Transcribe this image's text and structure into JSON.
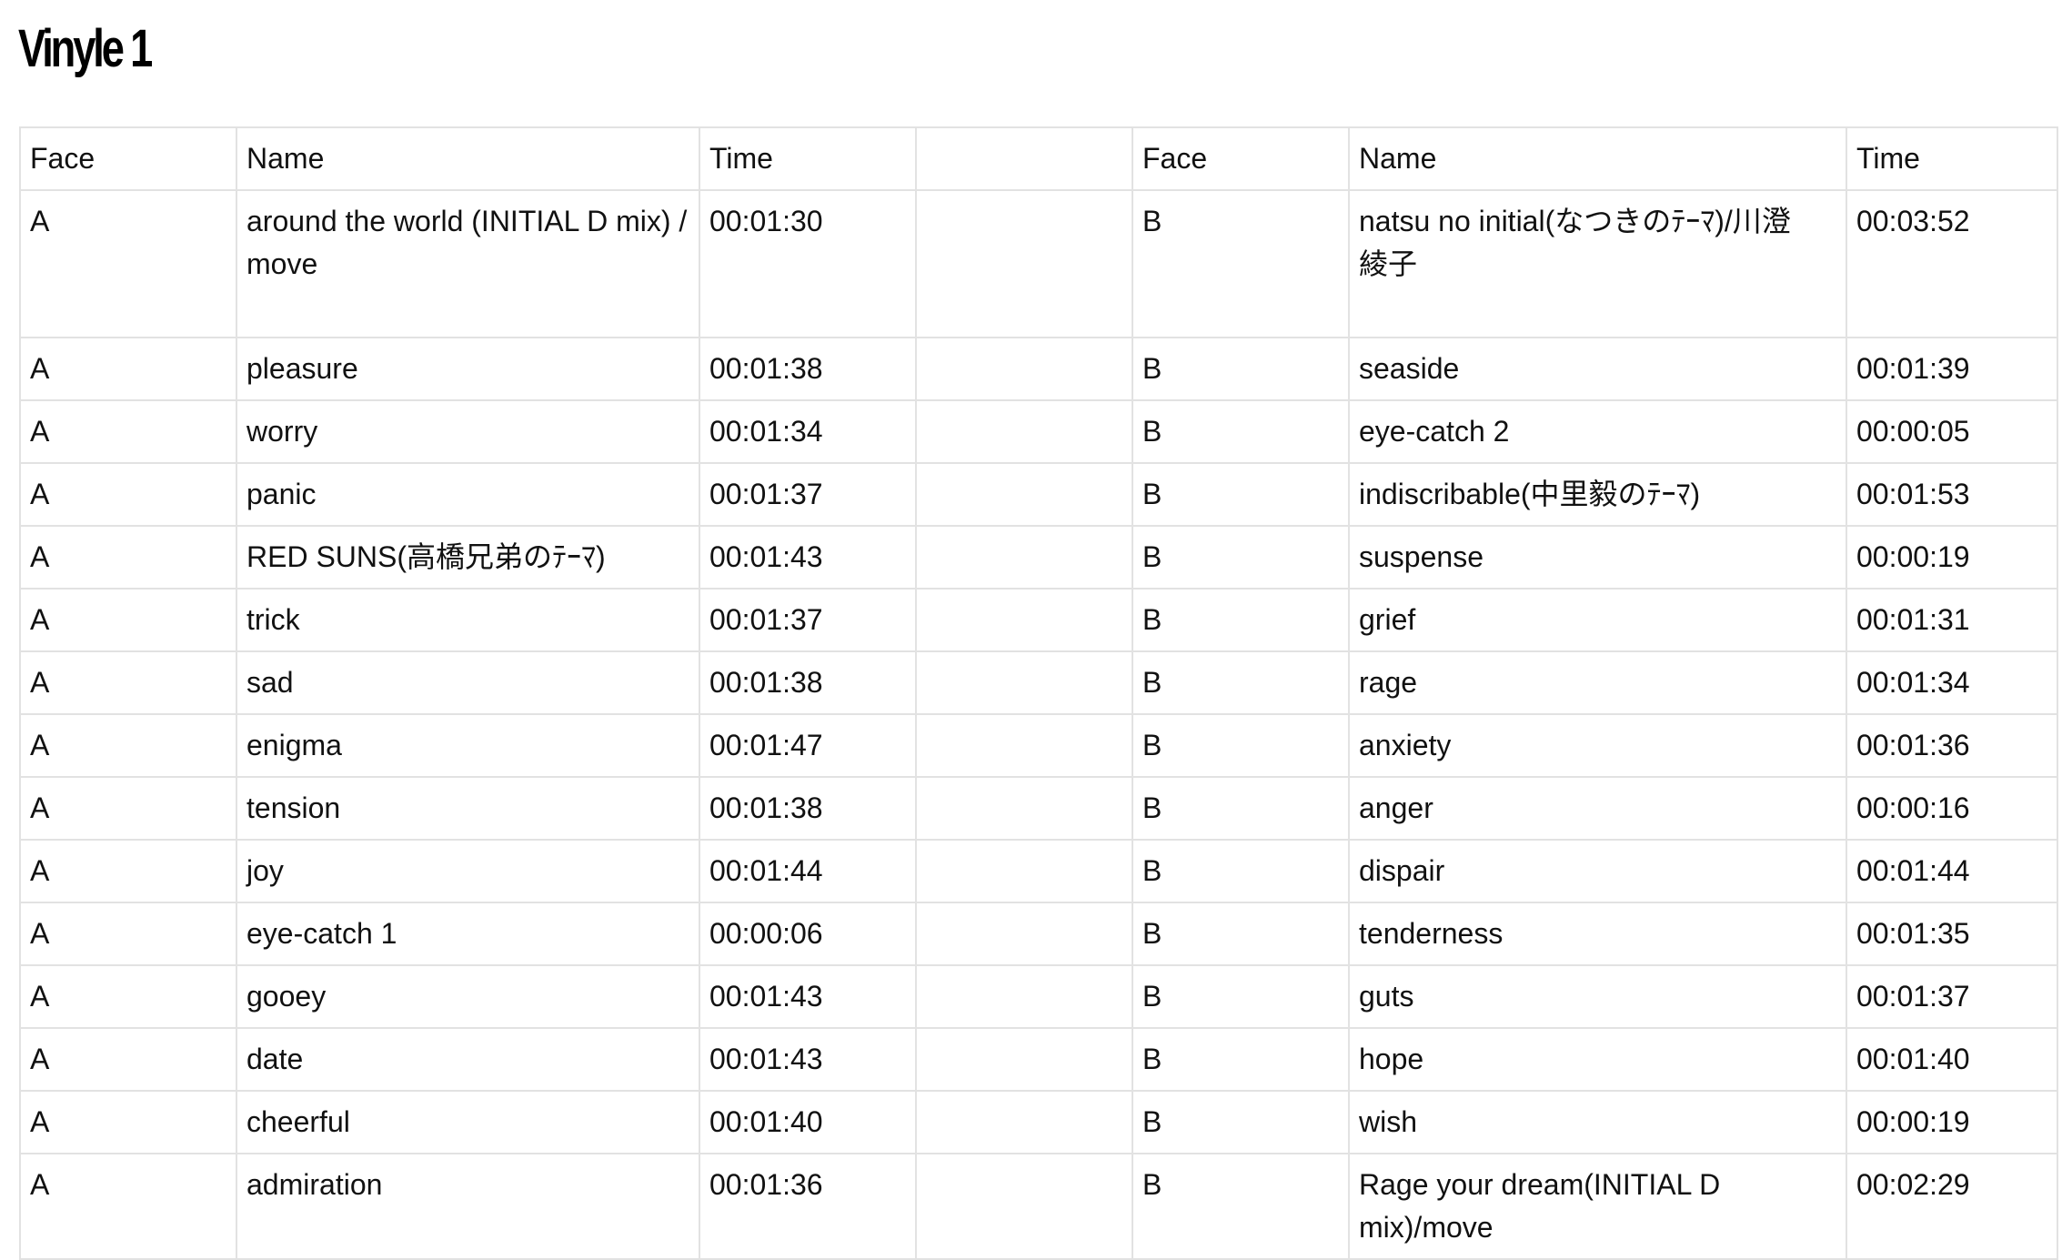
{
  "title": "Vinyle 1",
  "table": {
    "headers": [
      "Face",
      "Name",
      "Time",
      "",
      "Face",
      "Name",
      "Time"
    ],
    "rows": [
      {
        "face_a": "A",
        "name_a": "around the world (INITIAL D mix) / move",
        "time_a": "00:01:30",
        "face_b": "B",
        "name_b": "natsu no initial(なつきのﾃｰﾏ)/川澄\n綾子",
        "time_b": "00:03:52"
      },
      {
        "face_a": "A",
        "name_a": "pleasure",
        "time_a": "00:01:38",
        "face_b": "B",
        "name_b": "seaside",
        "time_b": "00:01:39"
      },
      {
        "face_a": "A",
        "name_a": "worry",
        "time_a": "00:01:34",
        "face_b": "B",
        "name_b": "eye-catch 2",
        "time_b": "00:00:05"
      },
      {
        "face_a": "A",
        "name_a": "panic",
        "time_a": "00:01:37",
        "face_b": "B",
        "name_b": "indiscribable(中里毅のﾃｰﾏ)",
        "time_b": "00:01:53"
      },
      {
        "face_a": "A",
        "name_a": "RED SUNS(高橋兄弟のﾃｰﾏ)",
        "time_a": "00:01:43",
        "face_b": "B",
        "name_b": "suspense",
        "time_b": "00:00:19"
      },
      {
        "face_a": "A",
        "name_a": "trick",
        "time_a": "00:01:37",
        "face_b": "B",
        "name_b": "grief",
        "time_b": "00:01:31"
      },
      {
        "face_a": "A",
        "name_a": "sad",
        "time_a": "00:01:38",
        "face_b": "B",
        "name_b": "rage",
        "time_b": "00:01:34"
      },
      {
        "face_a": "A",
        "name_a": "enigma",
        "time_a": "00:01:47",
        "face_b": "B",
        "name_b": "anxiety",
        "time_b": "00:01:36"
      },
      {
        "face_a": "A",
        "name_a": "tension",
        "time_a": "00:01:38",
        "face_b": "B",
        "name_b": "anger",
        "time_b": "00:00:16"
      },
      {
        "face_a": "A",
        "name_a": "joy",
        "time_a": "00:01:44",
        "face_b": "B",
        "name_b": "dispair",
        "time_b": "00:01:44"
      },
      {
        "face_a": "A",
        "name_a": "eye-catch 1",
        "time_a": "00:00:06",
        "face_b": "B",
        "name_b": "tenderness",
        "time_b": "00:01:35"
      },
      {
        "face_a": "A",
        "name_a": "gooey",
        "time_a": "00:01:43",
        "face_b": "B",
        "name_b": "guts",
        "time_b": "00:01:37"
      },
      {
        "face_a": "A",
        "name_a": "date",
        "time_a": "00:01:43",
        "face_b": "B",
        "name_b": "hope",
        "time_b": "00:01:40"
      },
      {
        "face_a": "A",
        "name_a": "cheerful",
        "time_a": "00:01:40",
        "face_b": "B",
        "name_b": "wish",
        "time_b": "00:00:19"
      },
      {
        "face_a": "A",
        "name_a": "admiration",
        "time_a": "00:01:36",
        "face_b": "B",
        "name_b": "Rage your dream(INITIAL D mix)/move",
        "time_b": "00:02:29"
      }
    ]
  }
}
